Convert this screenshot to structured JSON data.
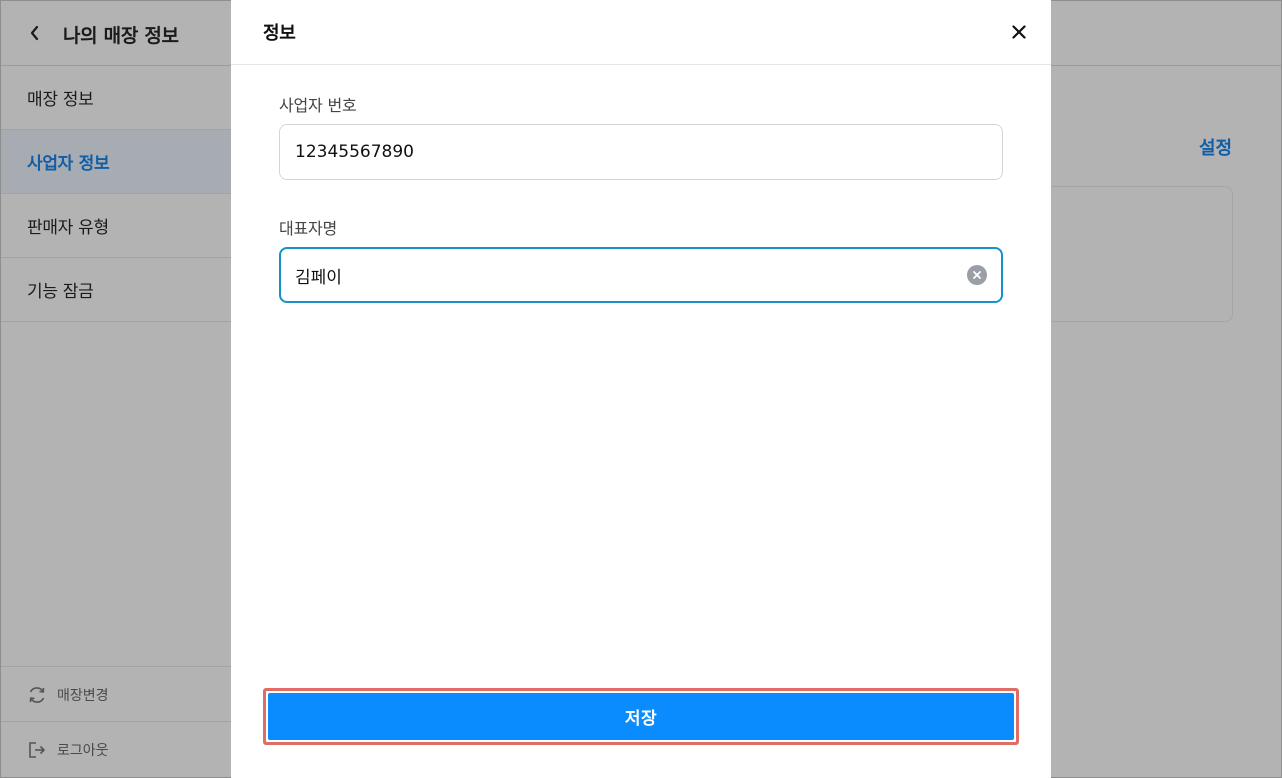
{
  "app": {
    "title": "나의 매장 정보",
    "sidebar": {
      "items": [
        {
          "label": "매장 정보",
          "active": false
        },
        {
          "label": "사업자 정보",
          "active": true
        },
        {
          "label": "판매자 유형",
          "active": false
        },
        {
          "label": "기능 잠금",
          "active": false
        }
      ],
      "change_store": "매장변경",
      "logout": "로그아웃"
    },
    "settings_link": "설정"
  },
  "modal": {
    "title": "정보",
    "fields": [
      {
        "label": "사업자 번호",
        "value": "12345567890",
        "focused": false
      },
      {
        "label": "대표자명",
        "value": "김페이",
        "focused": true
      }
    ],
    "save_label": "저장"
  },
  "colors": {
    "accent": "#0a8cff",
    "focus_border": "#1592c9",
    "link": "#115ea7",
    "highlight_outline": "#e06d64"
  },
  "icons": [
    "back-chevron-icon",
    "close-icon",
    "clear-icon",
    "refresh-icon",
    "logout-icon"
  ]
}
